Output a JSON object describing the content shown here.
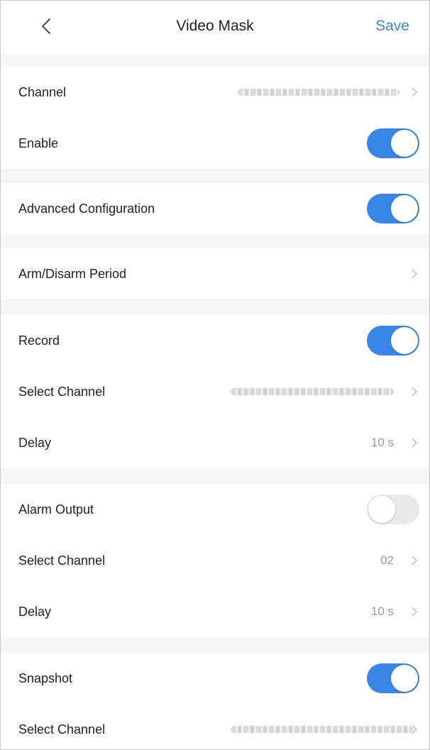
{
  "header": {
    "title": "Video Mask",
    "save_label": "Save",
    "back_icon": "chevron-left-icon"
  },
  "colors": {
    "accent": "#3a86e8",
    "toggle_off": "#e9e9e9",
    "section_gap": "#f5f5f5"
  },
  "rows": {
    "channel": {
      "label": "Channel"
    },
    "enable": {
      "label": "Enable",
      "state": "on"
    },
    "advanced": {
      "label": "Advanced Configuration",
      "state": "on"
    },
    "arm_disarm": {
      "label": "Arm/Disarm Period"
    },
    "record": {
      "label": "Record",
      "state": "on"
    },
    "record_select": {
      "label": "Select Channel"
    },
    "record_delay": {
      "label": "Delay",
      "value": "10 s"
    },
    "alarm_output": {
      "label": "Alarm Output",
      "state": "off"
    },
    "alarm_select": {
      "label": "Select Channel",
      "value": "02"
    },
    "alarm_delay": {
      "label": "Delay",
      "value": "10 s"
    },
    "snapshot": {
      "label": "Snapshot",
      "state": "on"
    },
    "snapshot_select": {
      "label": "Select Channel"
    }
  }
}
